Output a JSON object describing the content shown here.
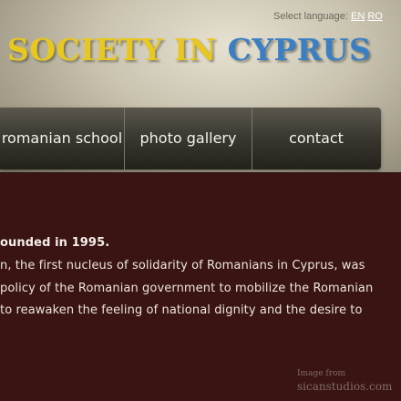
{
  "header": {
    "language_label": "Select language:",
    "languages": [
      "EN",
      "RO"
    ],
    "title_part1": "SOCIETY IN ",
    "title_part2": "CYPRUS"
  },
  "nav": {
    "items": [
      "romanian school",
      "photo gallery",
      "contact"
    ]
  },
  "content": {
    "lines": [
      "ounded in 1995.",
      "n, the first nucleus of solidarity of Romanians in Cyprus, was",
      " policy of the Romanian government to mobilize the Romanian",
      "to reawaken the feeling of national dignity and the desire to"
    ]
  },
  "watermark": {
    "line1": "Image from",
    "line2": "sicanstudios.com"
  },
  "colors": {
    "title_yellow": "#e8c81e",
    "title_blue": "#3a7fc4",
    "content_background": "#3a1413",
    "nav_background": "#2f2c25"
  }
}
